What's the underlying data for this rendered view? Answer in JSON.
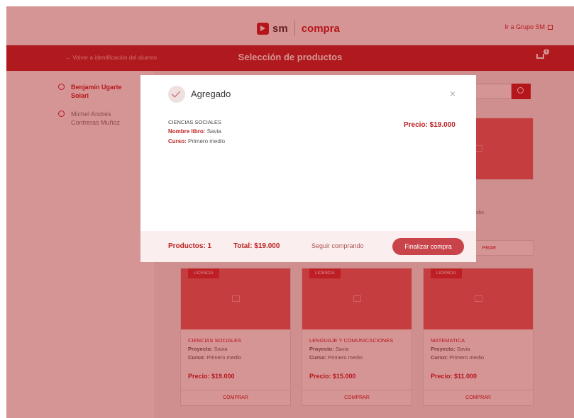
{
  "header": {
    "logo_sm": "sm",
    "logo_compra": "compra",
    "grupo_link": "Ir a Grupo SM"
  },
  "navbar": {
    "back_link": "← Volver a identificación del alumno",
    "title": "Selección de productos",
    "cart_count": "1"
  },
  "sidebar": {
    "students": [
      {
        "name": "Benjamín Ugarte Solari",
        "active": true
      },
      {
        "name": "Michel Andrés Contreras Muñoz",
        "active": false
      }
    ]
  },
  "top_card_fragment": {
    "course_fragment": "edio",
    "buy_fragment": "PRAR"
  },
  "cards": [
    {
      "badge": "LICENCIA",
      "subject": "CIENCIAS SOCIALES",
      "proyecto_label": "Proyecto:",
      "proyecto": "Savia",
      "curso_label": "Curso:",
      "curso": "Primero medio",
      "price": "Precio: $19.000",
      "buy": "COMPRAR"
    },
    {
      "badge": "LICENCIA",
      "subject": "LENGUAJE Y COMUNICACIONES",
      "proyecto_label": "Proyecto:",
      "proyecto": "Savia",
      "curso_label": "Curso:",
      "curso": "Primero medio",
      "price": "Precio: $15.000",
      "buy": "COMPRAR"
    },
    {
      "badge": "LICENCIA",
      "subject": "MATEMATICA",
      "proyecto_label": "Proyecto:",
      "proyecto": "Savia",
      "curso_label": "Curso:",
      "curso": "Primero medio",
      "price": "Precio: $11.000",
      "buy": "COMPRAR"
    }
  ],
  "modal": {
    "title": "Agregado",
    "close": "×",
    "subject": "CIENCIAS SOCIALES",
    "libro_label": "Nombre libro:",
    "libro": "Savia",
    "curso_label": "Curso:",
    "curso": "Primero medio",
    "price": "Precio: $19.000",
    "productos": "Productos: 1",
    "total": "Total: $19.000",
    "seguir": "Seguir comprando",
    "finalizar": "Finalizar compra"
  },
  "colors": {
    "brand": "#c0101a",
    "overlay": "rgba(168,30,30,0.47)"
  }
}
